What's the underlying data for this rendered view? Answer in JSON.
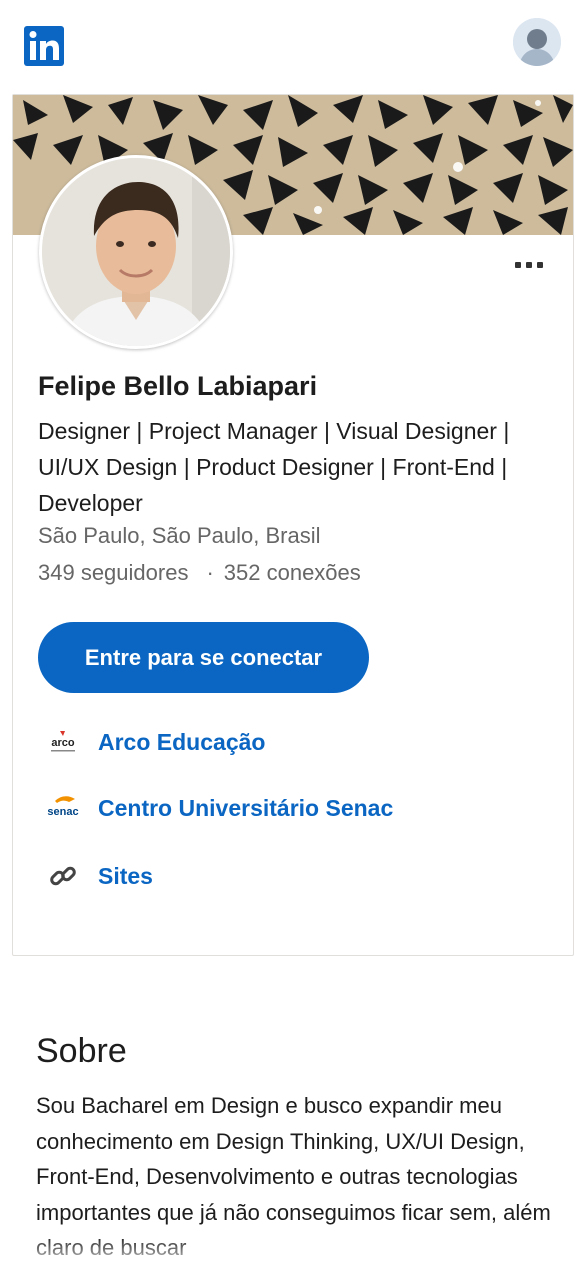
{
  "header": {
    "logo_icon": "linkedin-logo-icon",
    "avatar_icon": "user-avatar-icon"
  },
  "profile": {
    "name": "Felipe Bello Labiapari",
    "headline": "Designer | Project Manager | Visual Designer | UI/UX Design | Product Designer | Front-End | Developer",
    "location": "São Paulo, São Paulo, Brasil",
    "followers": "349 seguidores",
    "separator": "·",
    "connections": "352 conexões",
    "more_icon": "more-options-icon"
  },
  "actions": {
    "connect_label": "Entre para se conectar"
  },
  "links": [
    {
      "label": "Arco Educação",
      "icon": "arco-logo-icon",
      "logo_text": "arco"
    },
    {
      "label": "Centro Universitário Senac",
      "icon": "senac-logo-icon",
      "logo_text": "senac"
    },
    {
      "label": "Sites",
      "icon": "link-chain-icon"
    }
  ],
  "about": {
    "title": "Sobre",
    "text": "Sou Bacharel em Design e busco expandir meu conhecimento em Design Thinking, UX/UI Design, Front-End, Desenvolvimento e outras tecnologias importantes que já não conseguimos ficar sem, além claro de buscar"
  },
  "colors": {
    "brand_blue": "#0a66c2",
    "text_primary": "#1d1d1d",
    "text_secondary": "#666666"
  }
}
